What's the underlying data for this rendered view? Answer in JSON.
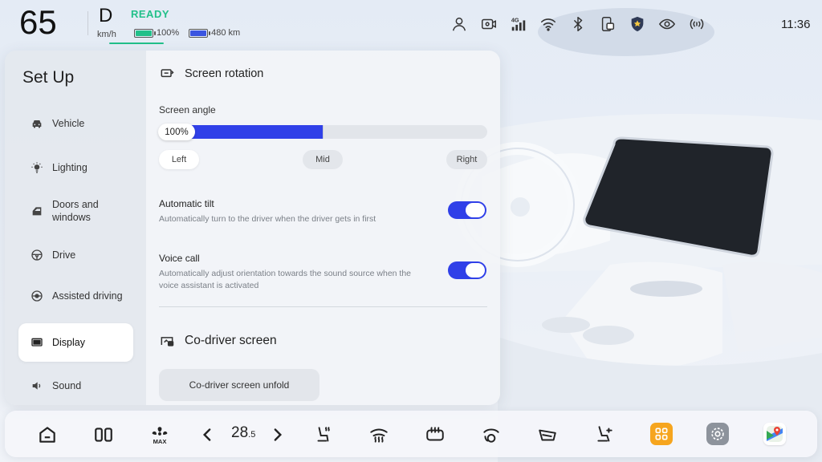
{
  "status": {
    "speed": "65",
    "speed_unit": "km/h",
    "gear": "D",
    "ready_text": "READY",
    "battery_percent": "100%",
    "battery_percent_level": 1.0,
    "range": "480 km",
    "time": "11:36",
    "network_label": "4G",
    "icons": [
      "person-icon",
      "dashcam-icon",
      "cellular-4g-icon",
      "wifi-icon",
      "bluetooth-icon",
      "phone-mirror-icon",
      "shield-badge-icon",
      "eye-icon",
      "radio-signal-icon"
    ]
  },
  "sidebar": {
    "title": "Set Up",
    "items": [
      {
        "label": "Vehicle",
        "icon": "car-icon"
      },
      {
        "label": "Lighting",
        "icon": "light-bulb-icon"
      },
      {
        "label": "Doors and windows",
        "icon": "door-icon"
      },
      {
        "label": "Drive",
        "icon": "steering-wheel-icon"
      },
      {
        "label": "Assisted driving",
        "icon": "assisted-driving-icon"
      },
      {
        "label": "Display",
        "icon": "display-icon",
        "active": true
      },
      {
        "label": "Sound",
        "icon": "speaker-icon"
      }
    ]
  },
  "content": {
    "rotation_title": "Screen rotation",
    "angle_label": "Screen angle",
    "angle_value": "100%",
    "angle_level": 0.5,
    "positions": [
      "Left",
      "Mid",
      "Right"
    ],
    "selected_position": "Left",
    "auto_tilt": {
      "title": "Automatic tilt",
      "desc": "Automatically turn to the driver when the driver gets in first",
      "enabled": true
    },
    "voice_call": {
      "title": "Voice call",
      "desc": "Automatically adjust orientation towards the sound source when the voice assistant is activated",
      "enabled": true
    },
    "codriver_title": "Co-driver screen",
    "codriver_button": "Co-driver screen unfold"
  },
  "dock": {
    "temperature_whole": "28",
    "temperature_decimal": ".5",
    "fan_max_label": "MAX",
    "icons": [
      "home-icon",
      "split-screen-icon",
      "fan-max-icon",
      "chevron-left-icon",
      "chevron-right-icon",
      "seat-heat-icon",
      "front-defrost-icon",
      "rear-defrost-icon",
      "steering-heat-icon",
      "windshield-icon",
      "seat-massage-icon",
      "apps-icon",
      "settings-icon",
      "maps-icon"
    ],
    "accent_orange": "#f6a51e",
    "accent_blue": "#3040e8"
  },
  "colors": {
    "accent": "#3040e8",
    "ready_green": "#22c08a"
  }
}
